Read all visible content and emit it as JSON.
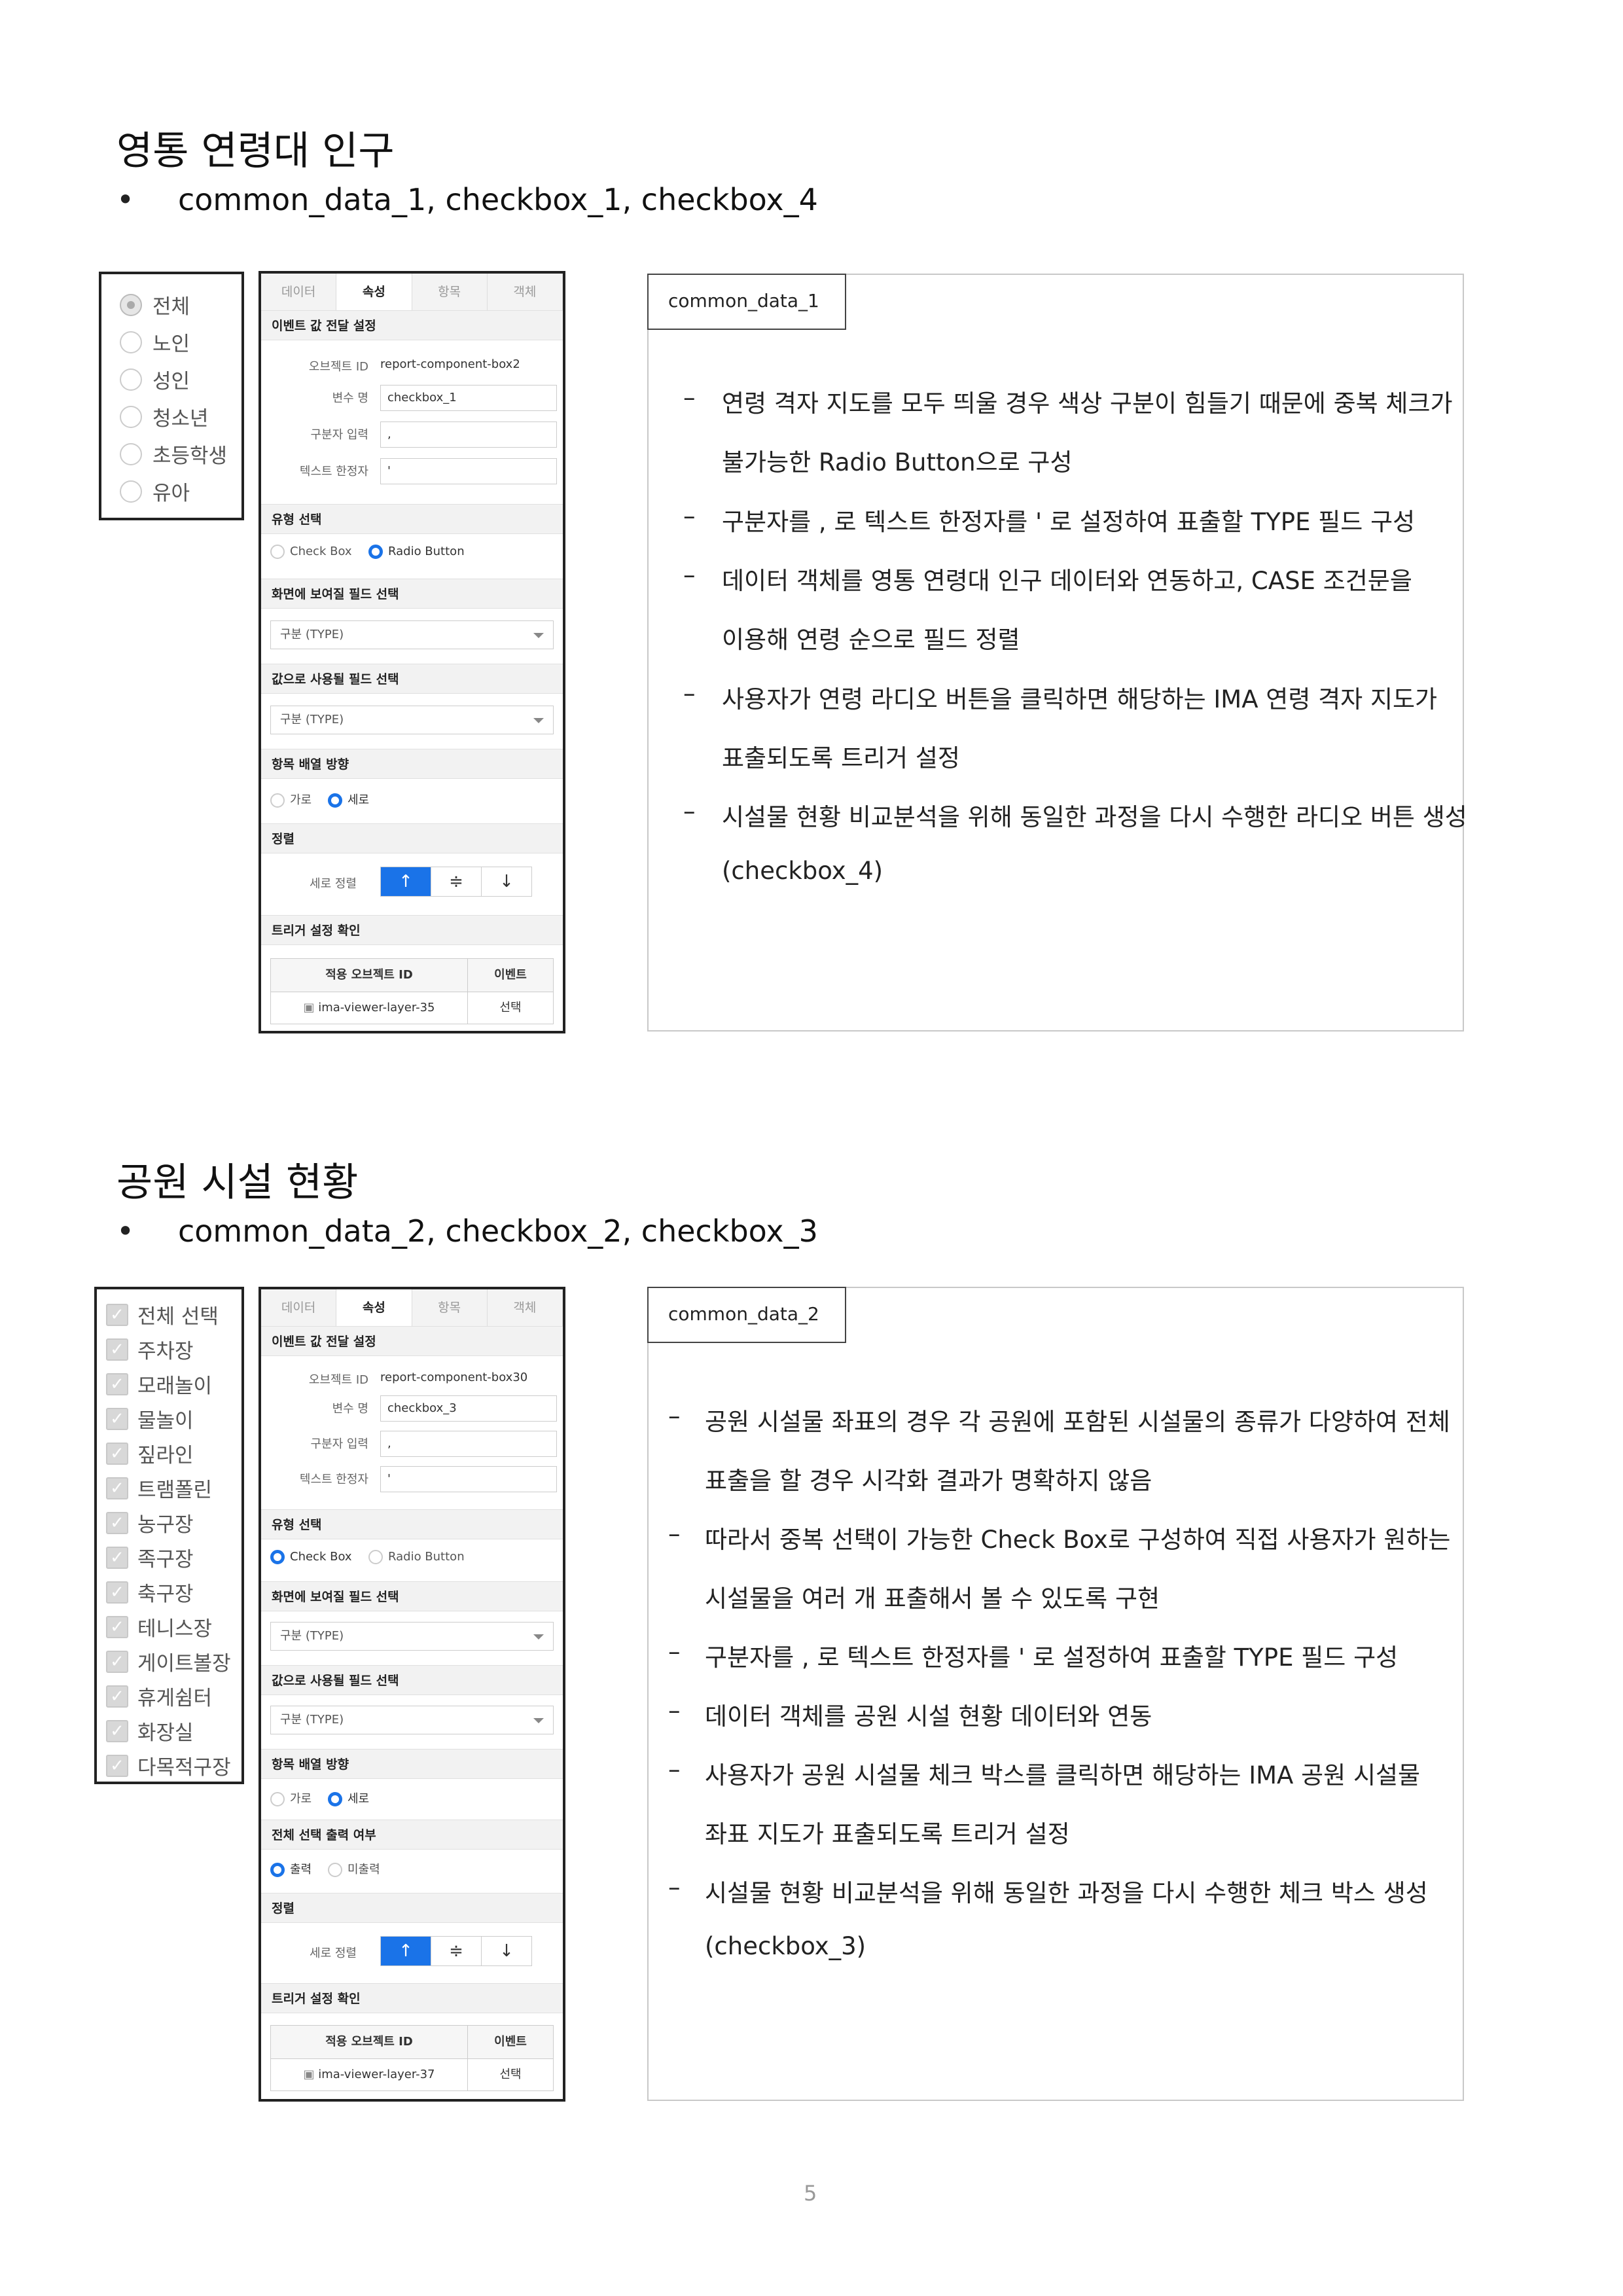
{
  "section1": {
    "title": "영통 연령대 인구",
    "bullet": "common_data_1, checkbox_1, checkbox_4",
    "options": [
      "전체",
      "노인",
      "성인",
      "청소년",
      "초등학생",
      "유아"
    ],
    "panel": {
      "tabs": [
        "데이터",
        "속성",
        "항목",
        "객체"
      ],
      "event_section": "이벤트 값 전달 설정",
      "object_id_label": "오브젝트 ID",
      "object_id_value": "report-component-box2",
      "var_label": "변수 명",
      "var_value": "checkbox_1",
      "sep_label": "구분자 입력",
      "sep_value": ",",
      "text_limit_label": "텍스트 한정자",
      "text_limit_value": "'",
      "type_section": "유형 선택",
      "type_options": [
        "Check Box",
        "Radio Button"
      ],
      "display_field_section": "화면에 보여질 필드 선택",
      "display_field_value": "구분 (TYPE)",
      "value_field_section": "값으로 사용될 필드 선택",
      "value_field_value": "구분 (TYPE)",
      "direction_section": "항목 배열 방향",
      "direction_options": [
        "가로",
        "세로"
      ],
      "align_section": "정렬",
      "vertical_align_label": "세로 정렬",
      "align_buttons": [
        "↑",
        "≑",
        "↓"
      ],
      "trigger_section": "트리거 설정 확인",
      "trigger_headers": [
        "적용 오브젝트 ID",
        "이벤트"
      ],
      "trigger_row": [
        "ima-viewer-layer-35",
        "선택"
      ]
    },
    "desc": {
      "tag": "common_data_1",
      "lines": [
        {
          "dash": true,
          "text": "연령 격자 지도를 모두 띄울 경우 색상 구분이 힘들기 때문에 중복 체크가"
        },
        {
          "dash": false,
          "text": "불가능한 Radio Button으로 구성"
        },
        {
          "dash": true,
          "text": "구분자를 , 로 텍스트 한정자를 ' 로 설정하여 표출할 TYPE 필드 구성"
        },
        {
          "dash": true,
          "text": "데이터 객체를 영통 연령대 인구 데이터와 연동하고, CASE 조건문을"
        },
        {
          "dash": false,
          "text": "이용해 연령 순으로 필드 정렬"
        },
        {
          "dash": true,
          "text": "사용자가 연령 라디오 버튼을 클릭하면 해당하는 IMA 연령 격자 지도가"
        },
        {
          "dash": false,
          "text": "표출되도록 트리거 설정"
        },
        {
          "dash": true,
          "text": "시설물 현황 비교분석을 위해 동일한 과정을 다시 수행한 라디오 버튼 생성"
        },
        {
          "dash": false,
          "text": "(checkbox_4)"
        }
      ]
    }
  },
  "section2": {
    "title": "공원 시설 현황",
    "bullet": "common_data_2, checkbox_2, checkbox_3",
    "options": [
      "전체 선택",
      "주차장",
      "모래놀이",
      "물놀이",
      "짚라인",
      "트램폴린",
      "농구장",
      "족구장",
      "축구장",
      "테니스장",
      "게이트볼장",
      "휴게쉼터",
      "화장실",
      "다목적구장"
    ],
    "panel": {
      "tabs": [
        "데이터",
        "속성",
        "항목",
        "객체"
      ],
      "event_section": "이벤트 값 전달 설정",
      "object_id_label": "오브젝트 ID",
      "object_id_value": "report-component-box30",
      "var_label": "변수 명",
      "var_value": "checkbox_3",
      "sep_label": "구분자 입력",
      "sep_value": ",",
      "text_limit_label": "텍스트 한정자",
      "text_limit_value": "'",
      "type_section": "유형 선택",
      "type_options": [
        "Check Box",
        "Radio Button"
      ],
      "display_field_section": "화면에 보여질 필드 선택",
      "display_field_value": "구분 (TYPE)",
      "value_field_section": "값으로 사용될 필드 선택",
      "value_field_value": "구분 (TYPE)",
      "direction_section": "항목 배열 방향",
      "direction_options": [
        "가로",
        "세로"
      ],
      "select_all_section": "전체 선택 출력 여부",
      "select_all_options": [
        "출력",
        "미출력"
      ],
      "align_section": "정렬",
      "vertical_align_label": "세로 정렬",
      "align_buttons": [
        "↑",
        "≑",
        "↓"
      ],
      "trigger_section": "트리거 설정 확인",
      "trigger_headers": [
        "적용 오브젝트 ID",
        "이벤트"
      ],
      "trigger_row": [
        "ima-viewer-layer-37",
        "선택"
      ]
    },
    "desc": {
      "tag": "common_data_2",
      "lines": [
        {
          "dash": true,
          "text": "공원 시설물 좌표의 경우 각 공원에 포함된 시설물의 종류가 다양하여 전체"
        },
        {
          "dash": false,
          "text": "표출을 할 경우 시각화 결과가 명확하지 않음"
        },
        {
          "dash": true,
          "text": "따라서 중복 선택이 가능한 Check Box로 구성하여 직접 사용자가 원하는"
        },
        {
          "dash": false,
          "text": "시설물을 여러 개 표출해서 볼 수 있도록 구현"
        },
        {
          "dash": true,
          "text": "구분자를 , 로 텍스트 한정자를 ' 로 설정하여 표출할 TYPE 필드 구성"
        },
        {
          "dash": true,
          "text": "데이터 객체를 공원 시설 현황 데이터와 연동"
        },
        {
          "dash": true,
          "text": "사용자가 공원 시설물 체크 박스를 클릭하면 해당하는 IMA 공원 시설물"
        },
        {
          "dash": false,
          "text": "좌표 지도가 표출되도록 트리거 설정"
        },
        {
          "dash": true,
          "text": "시설물 현황 비교분석을 위해 동일한 과정을 다시 수행한 체크 박스 생성"
        },
        {
          "dash": false,
          "text": "(checkbox_3)"
        }
      ]
    }
  },
  "footer": {
    "page_number": "5"
  }
}
